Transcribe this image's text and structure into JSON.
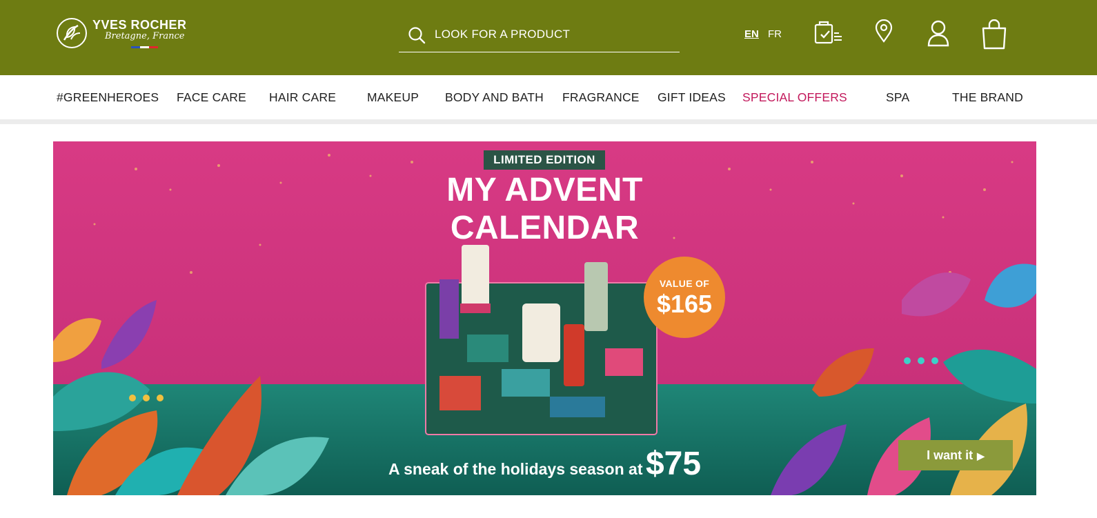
{
  "brand": {
    "name": "YVES ROCHER",
    "tagline": "Bretagne, France",
    "flag_colors": [
      "#2a52be",
      "#ffffff",
      "#e3262d"
    ]
  },
  "colors": {
    "header_bg": "#6e7c12",
    "special_offer": "#c2185b",
    "cta_bg": "#8b9a3b",
    "badge_bg": "#ee8a2f",
    "ribbon_bg": "#2b5446",
    "banner_bg": "#d93a84"
  },
  "search": {
    "placeholder": "LOOK FOR A PRODUCT",
    "icon": "search-icon"
  },
  "languages": {
    "en": "EN",
    "fr": "FR",
    "active": "EN"
  },
  "header_icons": [
    "order-tracking-icon",
    "store-locator-icon",
    "account-icon",
    "shopping-bag-icon"
  ],
  "nav": {
    "items": [
      {
        "label": "#GREENHEROES"
      },
      {
        "label": "FACE CARE"
      },
      {
        "label": "HAIR CARE"
      },
      {
        "label": "MAKEUP"
      },
      {
        "label": "BODY AND BATH"
      },
      {
        "label": "FRAGRANCE"
      },
      {
        "label": "GIFT IDEAS"
      },
      {
        "label": "SPECIAL OFFERS"
      },
      {
        "label": "SPA"
      },
      {
        "label": "THE BRAND"
      }
    ]
  },
  "banner": {
    "ribbon": "LIMITED EDITION",
    "title_line1": "MY ADVENT",
    "title_line2": "CALENDAR",
    "value_label": "VALUE OF",
    "value_amount": "$165",
    "tagline_text": "A sneak of the holidays season at",
    "tagline_price": "$75",
    "cta_label": "I want it",
    "cta_arrow": "▶"
  }
}
